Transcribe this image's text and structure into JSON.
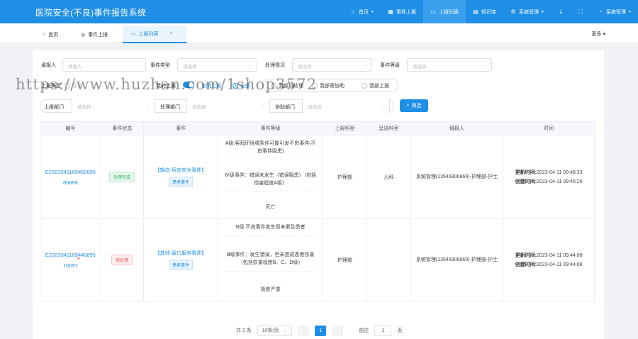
{
  "app": {
    "title": "医院安全(不良)事件报告系统"
  },
  "nav": [
    {
      "label": "首页",
      "icon": "home-icon"
    },
    {
      "label": "事件上报",
      "icon": "grid-icon"
    },
    {
      "label": "上报列表",
      "icon": "monitor-icon"
    },
    {
      "label": "知识库",
      "icon": "book-icon"
    },
    {
      "label": "系统管理",
      "icon": "gear-icon"
    },
    {
      "label": "系统管理",
      "icon": "user-icon"
    }
  ],
  "tabs": [
    {
      "label": "首页"
    },
    {
      "label": "事件上报"
    },
    {
      "label": "上报列表"
    }
  ],
  "tab_more": "更多",
  "filters": {
    "reporter_label": "填报人",
    "reporter_placeholder": "填报人",
    "type_label": "事件类型",
    "type_placeholder": "请选择",
    "handling_label": "处理情况",
    "handling_placeholder": "请选择",
    "level_label": "事件等级",
    "level_placeholder": "请选择",
    "report_type_label": "上报类型",
    "report_type_value": "匿名",
    "my_report_label": "我的上报",
    "scope_options": [
      "全院上报",
      "全部"
    ],
    "assist_options": [
      "我部协处理",
      "我部需协助",
      "我部上报"
    ],
    "report_dept_label": "上报部门",
    "report_dept_placeholder": "请选择",
    "handle_dept_label": "处理部门",
    "handle_dept_placeholder": "请选择",
    "assist_dept_label": "协助部门",
    "assist_dept_placeholder": "请选择",
    "search_button": "筛选"
  },
  "table": {
    "columns": [
      "编号",
      "事件状态",
      "事件",
      "事件等级",
      "上报科室",
      "呈送科室",
      "填报人",
      "时间"
    ],
    "rows": [
      {
        "id": "E202304110945269585866",
        "status": "处理完成",
        "event_name": "【输血-用血安全事件】",
        "event_tag": "患者事件",
        "levels": [
          "A级:客观环境或条件可能引发不良事件(不良事件隐患)",
          "Ⅳ级事件：错误未发生（错误隐患）（包括损害程度A级）",
          "死亡"
        ],
        "report_dept": "护理部",
        "send_dept": "儿科",
        "reporter": "系统管理(13546906869)-护理部-护士",
        "update_label": "更新时间:",
        "update_time": "2023-04-11 09:48:33",
        "create_label": "创建时间:",
        "create_time": "2023-04-11 09:45:26"
      },
      {
        "id": "E202304110944089510097",
        "status": "待处理",
        "event_name": "【其他-窗口服务事件】",
        "event_tag": "患者事件",
        "levels": [
          "B级:不良事件发生但未累及患者",
          "Ⅲ级事件：发生错误，但未造成患者伤害（包括损害程度B、C、D级）",
          "极度严重"
        ],
        "report_dept": "护理部",
        "send_dept": "",
        "reporter": "系统管理(13546906869)-护理部-护士",
        "update_label": "更新时间:",
        "update_time": "2023-04-11 09:44:08",
        "create_label": "创建时间:",
        "create_time": "2023-04-11 09:44:08"
      }
    ]
  },
  "pager": {
    "total": "共 2 条",
    "page_size": "10条/页",
    "current": "1",
    "goto_label": "前往",
    "goto_value": "1",
    "page_suffix": "页"
  },
  "watermark": "https://www.huzhan.com/1shop3572",
  "colors": {
    "primary": "#1f8fe6",
    "success": "#2fb36b",
    "danger": "#e45353"
  }
}
